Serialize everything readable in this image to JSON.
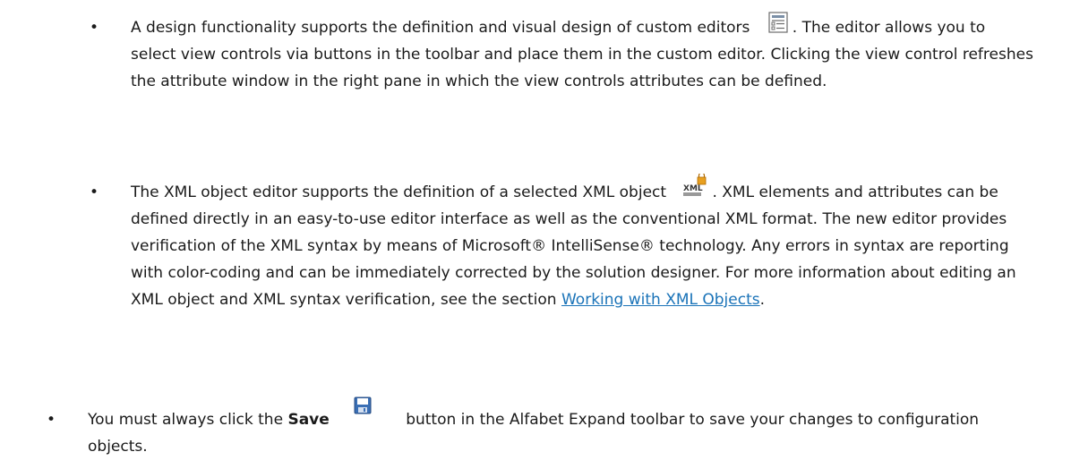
{
  "bullets": {
    "b1": {
      "text_before_icon": "A design functionality supports the definition and visual design of custom editors",
      "icon": "custom-editor-icon",
      "text_after_icon": ". The editor allows you to select view controls via buttons in the toolbar and place them in the custom editor. Clicking the view control refreshes the attribute window in the right pane in which the view controls attributes can be defined."
    },
    "b2": {
      "text_before_icon": "The XML object editor supports the definition of a selected XML object",
      "icon": "xml-object-lock-icon",
      "icon_text": "XML",
      "text_after_icon": ". XML elements and attributes can be defined directly in an easy-to-use editor interface as well as the conventional XML format. The new editor provides verification of the XML syntax by means of Microsoft® IntelliSense® technology. Any errors in syntax are reporting with color-coding and can be immediately corrected by the solution designer. For more information about editing an XML object and XML syntax verification, see the section",
      "link_text": "Working with XML Objects",
      "text_end": "."
    },
    "b3": {
      "text_before": "You must always click the",
      "bold_text": "Save",
      "icon": "save-floppy-icon",
      "text_after": "button in the Alfabet Expand toolbar to save your changes to configuration objects."
    }
  },
  "bullet_symbol": "•",
  "colors": {
    "link": "#1a73b8",
    "text": "#1a1a1a"
  }
}
